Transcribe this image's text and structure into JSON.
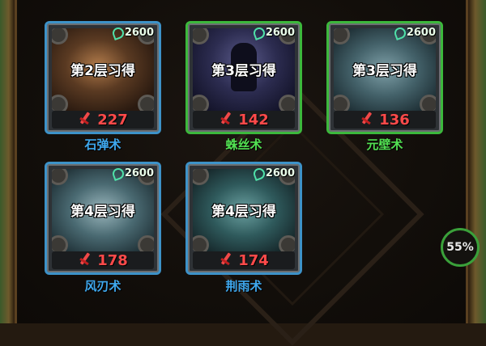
{
  "skills": [
    {
      "cost": "2600",
      "layer": "第2层习得",
      "power": "227",
      "name": "石弹术",
      "rarity": "blue",
      "art": "rock"
    },
    {
      "cost": "2600",
      "layer": "第3层习得",
      "power": "142",
      "name": "蛛丝术",
      "rarity": "green",
      "art": "spider"
    },
    {
      "cost": "2600",
      "layer": "第3层习得",
      "power": "136",
      "name": "元壁术",
      "rarity": "green",
      "art": "wall"
    },
    {
      "cost": "2600",
      "layer": "第4层习得",
      "power": "178",
      "name": "风刃术",
      "rarity": "blue",
      "art": "wind"
    },
    {
      "cost": "2600",
      "layer": "第4层习得",
      "power": "174",
      "name": "荆雨术",
      "rarity": "blue",
      "art": "rain"
    }
  ],
  "progress": {
    "label": "55%",
    "value": 0.55
  },
  "colors": {
    "blue_frame": "#3d92c8",
    "green_frame": "#3cb83c",
    "power": "#ff4a4a",
    "cost_icon": "#4fe0a8"
  },
  "icons": {
    "cost": "jade-swirl-icon",
    "power": "sword-icon"
  }
}
